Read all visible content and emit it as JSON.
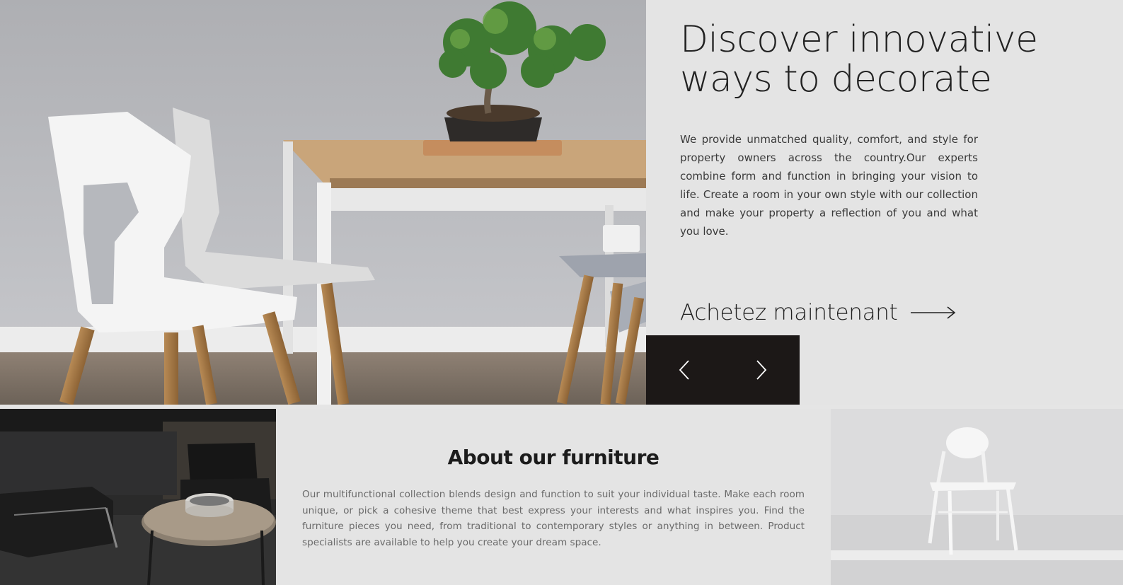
{
  "hero": {
    "image_icon": "dining-room-photo",
    "title": "Discover innovative ways to decorate",
    "description": "We provide unmatched quality, comfort, and style for property owners across the country.Our experts combine form and function in bringing your vision to life. Create a room in your own style with our collection and make your property a reflection of you and what you love.",
    "cta_label": "Achetez maintenant",
    "cta_icon": "long-arrow-right-icon"
  },
  "slider": {
    "prev_icon": "chevron-left-icon",
    "next_icon": "chevron-right-icon",
    "background": "#1c1817"
  },
  "about": {
    "title": "About our furniture",
    "text": "Our multifunctional collection blends design and function to suit your individual taste. Make each room unique, or pick a cohesive theme that best express your interests and what inspires you. Find the furniture pieces you need, from traditional to contemporary styles or anything in between. Product specialists are available to help you create your dream space.",
    "left_image_icon": "lounge-chairs-photo",
    "right_image_icon": "white-chair-photo"
  },
  "colors": {
    "panel_background": "#e4e4e4",
    "dark_accent": "#1c1817",
    "heading_text": "#222222",
    "body_text": "#6a6a6a"
  }
}
